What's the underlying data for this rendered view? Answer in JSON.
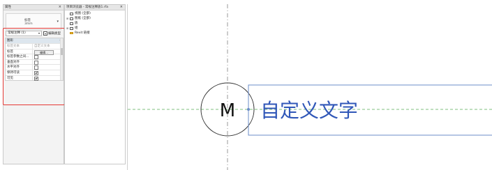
{
  "properties_palette": {
    "title": "属性",
    "close_glyph": "×",
    "type_selector": {
      "family_label": "标签",
      "size_label": "3mm",
      "dropdown_glyph": "▾"
    },
    "instance_selector": {
      "value": "常规注释 (1)",
      "dropdown_glyph": "▾"
    },
    "edit_type_label": "编辑类型",
    "section_title": "图形",
    "section_caret": "«",
    "grid_header": {
      "col1": "标签文本",
      "col2": "自定义文本"
    },
    "rows": [
      {
        "label": "标签",
        "type": "button",
        "value": "编辑..."
      },
      {
        "label": "标签参数之间...",
        "type": "checkbox",
        "checked": false
      },
      {
        "label": "垂直对齐",
        "type": "checkbox",
        "checked": false
      },
      {
        "label": "水平对齐",
        "type": "checkbox",
        "checked": false
      },
      {
        "label": "保持可读",
        "type": "checkbox",
        "checked": true
      },
      {
        "label": "可见",
        "type": "checkbox",
        "checked": true
      }
    ]
  },
  "project_browser": {
    "title": "项目浏览器 - 常规注释族1.rfa",
    "close_glyph": "×",
    "tree": [
      {
        "label": "视图 (全部)",
        "expander": "",
        "icon": "view-icon"
      },
      {
        "label": "图纸 (全部)",
        "expander": "⊞",
        "icon": "sheet-icon"
      },
      {
        "label": "族",
        "expander": "",
        "icon": "family-icon"
      },
      {
        "label": "组",
        "expander": "⊞",
        "icon": "group-icon"
      },
      {
        "label": "Revit 链接",
        "expander": "",
        "icon": "revit-link-icon"
      }
    ]
  },
  "canvas": {
    "symbol_letter": "M",
    "custom_text": "自定义文字",
    "colors": {
      "ref_line_green": "#7fbf7f",
      "ref_line_gray": "#9a9a9a",
      "text_blue": "#3057b8",
      "box_blue": "#6b8cc8"
    }
  },
  "highlight_color": "#e53935"
}
